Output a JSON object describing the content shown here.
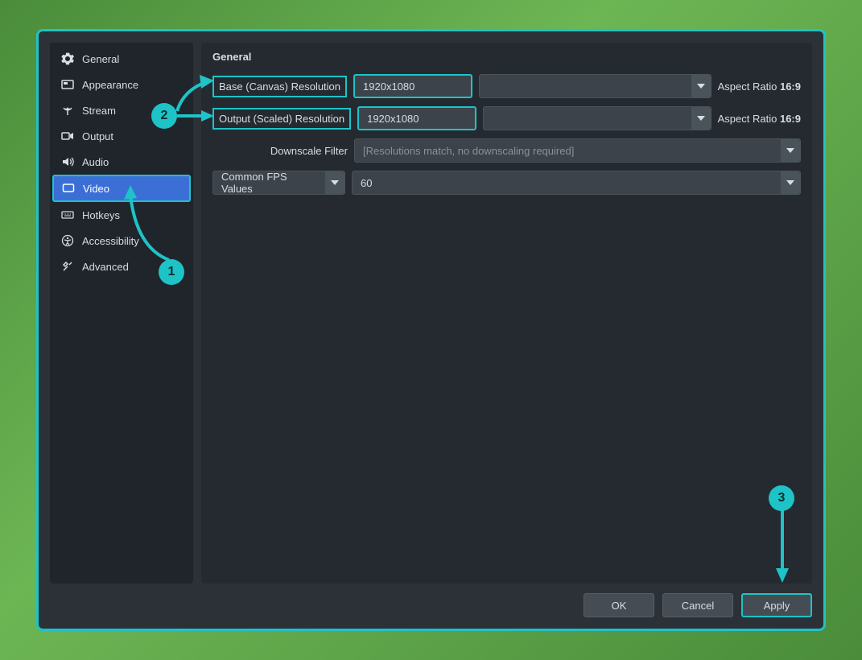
{
  "sidebar": {
    "items": [
      {
        "label": "General"
      },
      {
        "label": "Appearance"
      },
      {
        "label": "Stream"
      },
      {
        "label": "Output"
      },
      {
        "label": "Audio"
      },
      {
        "label": "Video"
      },
      {
        "label": "Hotkeys"
      },
      {
        "label": "Accessibility"
      },
      {
        "label": "Advanced"
      }
    ]
  },
  "content": {
    "section_title": "General",
    "base_label": "Base (Canvas) Resolution",
    "base_value": "1920x1080",
    "output_label": "Output (Scaled) Resolution",
    "output_value": "1920x1080",
    "aspect_label": "Aspect Ratio",
    "aspect_value": "16:9",
    "downscale_label": "Downscale Filter",
    "downscale_value": "[Resolutions match, no downscaling required]",
    "fps_type_label": "Common FPS Values",
    "fps_value": "60"
  },
  "buttons": {
    "ok": "OK",
    "cancel": "Cancel",
    "apply": "Apply"
  },
  "callouts": {
    "c1": "1",
    "c2": "2",
    "c3": "3"
  }
}
